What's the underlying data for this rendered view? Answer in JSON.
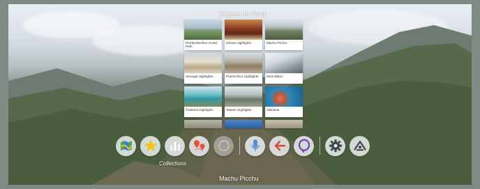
{
  "panel": {
    "title": "Places to Visit",
    "cards": [
      {
        "label": "Pembrokeshire Coast Path"
      },
      {
        "label": "Ghana Highlights"
      },
      {
        "label": "Machu Picchu"
      },
      {
        "label": "Senegal Highlights"
      },
      {
        "label": "Puerto Rico Highlights"
      },
      {
        "label": "Mont Blanc"
      },
      {
        "label": "Thailand Highlights"
      },
      {
        "label": "Taiwan Highlights"
      },
      {
        "label": "Okinawa"
      }
    ]
  },
  "dock": {
    "buttons": [
      {
        "icon": "map-icon"
      },
      {
        "icon": "star-icon"
      },
      {
        "icon": "collections-icon"
      },
      {
        "icon": "places-pin-icon"
      },
      {
        "icon": "globe-icon"
      },
      {
        "icon": "microphone-icon"
      },
      {
        "icon": "back-arrow-icon"
      },
      {
        "icon": "lasso-icon"
      },
      {
        "icon": "gear-icon"
      },
      {
        "icon": "pegman-icon"
      }
    ],
    "collections_label": "Collections"
  },
  "location": {
    "name": "Machu Picchu"
  },
  "colors": {
    "accent_yellow": "#f5c518",
    "lasso_purple": "#7b3fb4",
    "pin_red": "#e5533d",
    "mic_blue": "#5a8fd6"
  }
}
